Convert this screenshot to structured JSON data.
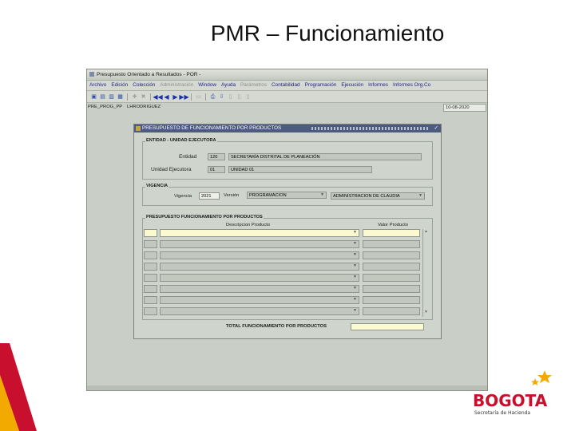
{
  "slide": {
    "title": "PMR – Funcionamiento"
  },
  "window": {
    "title": "Presupuesto Orientado a Resultados - POR -"
  },
  "menu": {
    "items": [
      "Archivo",
      "Edición",
      "Colección",
      "Administración",
      "Window",
      "Ayuda",
      "Parámetros",
      "Contabilidad",
      "Programación",
      "Ejecución",
      "Informes",
      "Informes Org.Co"
    ]
  },
  "toolbar": {
    "icons": [
      "save-icon",
      "print-icon",
      "print-icon",
      "delete-icon",
      "insert-icon",
      "remove-icon",
      "first-record-icon",
      "previous-record-icon",
      "next-record-icon",
      "last-record-icon",
      "disk-icon",
      "printer-icon",
      "download-icon"
    ]
  },
  "status": {
    "module": "PRE_PROG_PP",
    "user": "LHRODRIGUEZ",
    "date": "10-08-2020"
  },
  "form": {
    "title": "PRESUPUESTO DE FUNCIONAMIENTO POR PRODUCTOS",
    "close": "✓",
    "entidad_section": {
      "label": "ENTIDAD - UNIDAD EJECUTORA",
      "entidad_label": "Entidad",
      "entidad_code": "120",
      "entidad_name": "SECRETARÍA DISTRITAL DE PLANEACIÓN",
      "unidad_label": "Unidad Ejecutora",
      "unidad_code": "01",
      "unidad_name": "UNIDAD 01"
    },
    "vigencia_section": {
      "label": "VIGENCIA",
      "vigencia_label": "Vigencia",
      "vigencia_value": "2021",
      "version_label": "Versión",
      "version_value": "PROGRAMACION",
      "admin_value": "ADMINISTRACION DE CLAUDIA"
    },
    "productos_section": {
      "label": "PRESUPUESTO FUNCIONAMIENTO POR PRODUCTOS",
      "col_descripcion": "Descripcion Producto",
      "col_valor": "Valor Producto",
      "rows": [
        {
          "descripcion": "",
          "valor": ""
        },
        {
          "descripcion": "",
          "valor": ""
        },
        {
          "descripcion": "",
          "valor": ""
        },
        {
          "descripcion": "",
          "valor": ""
        },
        {
          "descripcion": "",
          "valor": ""
        },
        {
          "descripcion": "",
          "valor": ""
        },
        {
          "descripcion": "",
          "valor": ""
        },
        {
          "descripcion": "",
          "valor": ""
        }
      ]
    },
    "total_label": "TOTAL FUNCIONAMIENTO POR PRODUCTOS",
    "total_value": ""
  },
  "logo": {
    "name": "BOGOTA",
    "subtitle": "Secretaría de Hacienda"
  },
  "colors": {
    "form_title_bg": "#4d5b7e",
    "field_yellow": "#fbf9cf",
    "logo_red": "#c8102e",
    "logo_gold": "#f2a900"
  }
}
